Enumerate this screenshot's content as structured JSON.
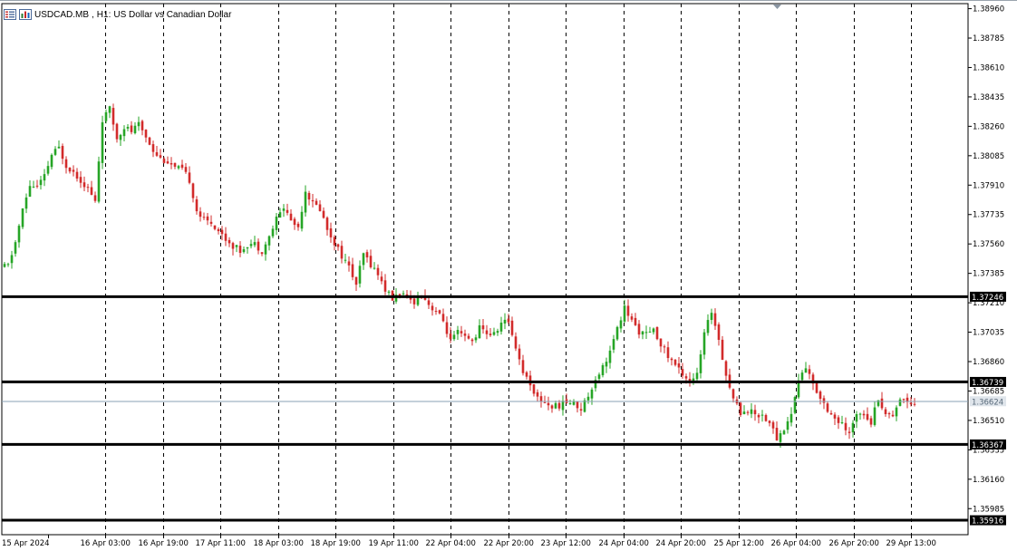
{
  "chart": {
    "symbol": "USDCAD.MB",
    "timeframe": "H1:",
    "description": "US Dollar vs Canadian Dollar"
  },
  "colors": {
    "bull": "#26a526",
    "bear": "#d22b2b",
    "grid": "#000000",
    "level": "#000000",
    "current": "#8aa0b4",
    "current_label_bg": "#dfe5eb"
  },
  "icons": {
    "left": "list-icon",
    "right": "chart-bars-icon"
  },
  "chart_data": {
    "type": "candlestick",
    "ylim": [
      1.3583,
      1.3899
    ],
    "y_ticks": [
      "1.38960",
      "1.38785",
      "1.38610",
      "1.38435",
      "1.38260",
      "1.38085",
      "1.37910",
      "1.37735",
      "1.37560",
      "1.37385",
      "1.37210",
      "1.37035",
      "1.36860",
      "1.36685",
      "1.36510",
      "1.36335",
      "1.36160",
      "1.35985"
    ],
    "x_ticks": [
      "15 Apr 2024",
      "16 Apr 03:00",
      "16 Apr 19:00",
      "17 Apr 11:00",
      "18 Apr 03:00",
      "18 Apr 19:00",
      "19 Apr 11:00",
      "22 Apr 04:00",
      "22 Apr 20:00",
      "23 Apr 12:00",
      "24 Apr 04:00",
      "24 Apr 20:00",
      "25 Apr 12:00",
      "26 Apr 04:00",
      "26 Apr 20:00",
      "29 Apr 13:00"
    ],
    "levels": [
      {
        "value": 1.37246,
        "label": "1.37246"
      },
      {
        "value": 1.36739,
        "label": "1.36739"
      },
      {
        "value": 1.36367,
        "label": "1.36367"
      },
      {
        "value": 1.35916,
        "label": "1.35916"
      }
    ],
    "current_price": {
      "value": 1.36624,
      "label": "1.36624"
    },
    "waypoints": [
      [
        0,
        1.3742
      ],
      [
        2,
        1.3743
      ],
      [
        4,
        1.3757
      ],
      [
        6,
        1.3776
      ],
      [
        8,
        1.3791
      ],
      [
        10,
        1.379
      ],
      [
        12,
        1.3796
      ],
      [
        14,
        1.3809
      ],
      [
        16,
        1.3813
      ],
      [
        18,
        1.3803
      ],
      [
        20,
        1.3799
      ],
      [
        22,
        1.3794
      ],
      [
        24,
        1.3789
      ],
      [
        26,
        1.3781
      ],
      [
        28,
        1.383
      ],
      [
        30,
        1.3836
      ],
      [
        32,
        1.3819
      ],
      [
        34,
        1.3826
      ],
      [
        36,
        1.3823
      ],
      [
        38,
        1.3827
      ],
      [
        40,
        1.382
      ],
      [
        42,
        1.3812
      ],
      [
        44,
        1.3807
      ],
      [
        46,
        1.3805
      ],
      [
        48,
        1.3801
      ],
      [
        50,
        1.38
      ],
      [
        52,
        1.3794
      ],
      [
        54,
        1.3776
      ],
      [
        56,
        1.377
      ],
      [
        58,
        1.3769
      ],
      [
        60,
        1.3764
      ],
      [
        62,
        1.3759
      ],
      [
        64,
        1.3755
      ],
      [
        66,
        1.3752
      ],
      [
        68,
        1.3756
      ],
      [
        70,
        1.3756
      ],
      [
        72,
        1.3752
      ],
      [
        74,
        1.376
      ],
      [
        76,
        1.3771
      ],
      [
        78,
        1.3778
      ],
      [
        80,
        1.377
      ],
      [
        82,
        1.3766
      ],
      [
        84,
        1.3788
      ],
      [
        86,
        1.378
      ],
      [
        88,
        1.3777
      ],
      [
        90,
        1.3765
      ],
      [
        92,
        1.3757
      ],
      [
        94,
        1.3749
      ],
      [
        96,
        1.3742
      ],
      [
        98,
        1.3732
      ],
      [
        100,
        1.375
      ],
      [
        102,
        1.3744
      ],
      [
        104,
        1.3738
      ],
      [
        106,
        1.3729
      ],
      [
        108,
        1.3723
      ],
      [
        110,
        1.3727
      ],
      [
        112,
        1.3723
      ],
      [
        114,
        1.3722
      ],
      [
        116,
        1.3727
      ],
      [
        118,
        1.372
      ],
      [
        120,
        1.3716
      ],
      [
        122,
        1.371
      ],
      [
        124,
        1.3698
      ],
      [
        126,
        1.3703
      ],
      [
        128,
        1.37
      ],
      [
        130,
        1.3698
      ],
      [
        132,
        1.3706
      ],
      [
        134,
        1.3703
      ],
      [
        136,
        1.3702
      ],
      [
        138,
        1.3709
      ],
      [
        140,
        1.371
      ],
      [
        142,
        1.3695
      ],
      [
        144,
        1.368
      ],
      [
        146,
        1.3673
      ],
      [
        148,
        1.3664
      ],
      [
        150,
        1.3662
      ],
      [
        152,
        1.3659
      ],
      [
        154,
        1.366
      ],
      [
        156,
        1.3662
      ],
      [
        158,
        1.3661
      ],
      [
        160,
        1.3658
      ],
      [
        162,
        1.3666
      ],
      [
        164,
        1.3676
      ],
      [
        166,
        1.3683
      ],
      [
        168,
        1.3692
      ],
      [
        170,
        1.3705
      ],
      [
        172,
        1.3718
      ],
      [
        174,
        1.371
      ],
      [
        176,
        1.3704
      ],
      [
        178,
        1.3702
      ],
      [
        180,
        1.3704
      ],
      [
        182,
        1.3697
      ],
      [
        184,
        1.3689
      ],
      [
        186,
        1.3684
      ],
      [
        188,
        1.3679
      ],
      [
        190,
        1.3675
      ],
      [
        192,
        1.3678
      ],
      [
        194,
        1.3702
      ],
      [
        196,
        1.3716
      ],
      [
        198,
        1.37
      ],
      [
        200,
        1.3678
      ],
      [
        202,
        1.3664
      ],
      [
        204,
        1.3656
      ],
      [
        206,
        1.3657
      ],
      [
        208,
        1.3655
      ],
      [
        210,
        1.3654
      ],
      [
        212,
        1.365
      ],
      [
        214,
        1.364
      ],
      [
        216,
        1.3646
      ],
      [
        218,
        1.3655
      ],
      [
        220,
        1.3675
      ],
      [
        222,
        1.3683
      ],
      [
        224,
        1.3672
      ],
      [
        226,
        1.3665
      ],
      [
        228,
        1.3658
      ],
      [
        230,
        1.3652
      ],
      [
        232,
        1.3648
      ],
      [
        234,
        1.3642
      ],
      [
        236,
        1.3656
      ],
      [
        238,
        1.3656
      ],
      [
        240,
        1.365
      ],
      [
        242,
        1.3665
      ],
      [
        244,
        1.3654
      ],
      [
        246,
        1.3655
      ],
      [
        248,
        1.3664
      ],
      [
        251,
        1.3662
      ]
    ]
  }
}
